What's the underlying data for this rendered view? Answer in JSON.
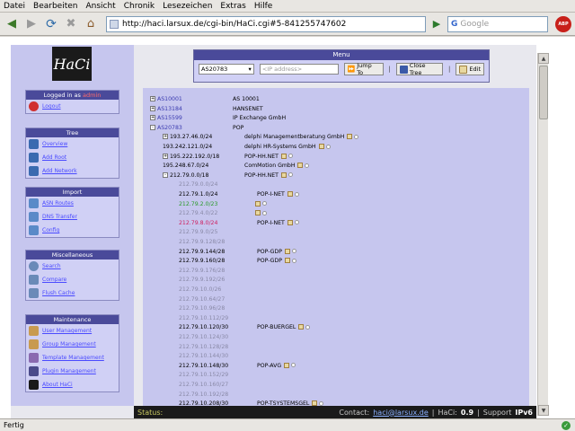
{
  "browser": {
    "menu": [
      "Datei",
      "Bearbeiten",
      "Ansicht",
      "Chronik",
      "Lesezeichen",
      "Extras",
      "Hilfe"
    ],
    "url": "http://haci.larsux.de/cgi-bin/HaCi.cgi#5-841255747602",
    "search_placeholder": "Google",
    "adblock_label": "ABP",
    "status": "Fertig"
  },
  "sidebar": {
    "logo": "HaCi",
    "login": {
      "header": "Logged in as",
      "user": "admin",
      "items": [
        "Logout"
      ]
    },
    "tree": {
      "header": "Tree",
      "items": [
        "Overview",
        "Add Root",
        "Add Network"
      ]
    },
    "import": {
      "header": "Import",
      "items": [
        "ASN Routes",
        "DNS Transfer",
        "Config"
      ]
    },
    "misc": {
      "header": "Miscellaneous",
      "items": [
        "Search",
        "Compare",
        "Flush Cache"
      ]
    },
    "maint": {
      "header": "Maintenance",
      "items": [
        "User Management",
        "Group Management",
        "Template Management",
        "Plugin Management",
        "About HaCi"
      ]
    }
  },
  "menu_panel": {
    "title": "Menu",
    "root_select": "AS20783",
    "ip_placeholder": "<IP address>",
    "jump_label": "Jump To",
    "close_label": "Close Tree",
    "edit_label": "Edit"
  },
  "tree": [
    {
      "exp": "+",
      "net": "AS10001",
      "desc": "AS 10001",
      "cls": "lnk",
      "indent": 0,
      "icons": false
    },
    {
      "exp": "+",
      "net": "AS13184",
      "desc": "HANSENET",
      "cls": "lnk",
      "indent": 0,
      "icons": false
    },
    {
      "exp": "+",
      "net": "AS15599",
      "desc": "IP Exchange GmbH",
      "cls": "lnk",
      "indent": 0,
      "icons": false
    },
    {
      "exp": "-",
      "net": "AS20783",
      "desc": "POP",
      "cls": "lnk",
      "indent": 0,
      "icons": false
    },
    {
      "exp": "+",
      "net": "193.27.46.0/24",
      "desc": "delphi Managementberatung GmbH",
      "cls": "",
      "indent": 1,
      "icons": true
    },
    {
      "exp": "",
      "net": "193.242.121.0/24",
      "desc": "delphi HR-Systems GmbH",
      "cls": "",
      "indent": 1,
      "icons": true
    },
    {
      "exp": "+",
      "net": "195.222.192.0/18",
      "desc": "POP-HH.NET",
      "cls": "",
      "indent": 1,
      "icons": true
    },
    {
      "exp": "",
      "net": "195.248.67.0/24",
      "desc": "ComMotion GmbH",
      "cls": "",
      "indent": 1,
      "icons": true
    },
    {
      "exp": "-",
      "net": "212.79.0.0/18",
      "desc": "POP-HH.NET",
      "cls": "",
      "indent": 1,
      "icons": true
    },
    {
      "exp": "",
      "net": "212.79.0.0/24",
      "desc": "",
      "cls": "grey",
      "indent": 2,
      "icons": false
    },
    {
      "exp": "",
      "net": "212.79.1.0/24",
      "desc": "POP-I-NET",
      "cls": "",
      "indent": 2,
      "icons": true
    },
    {
      "exp": "",
      "net": "212.79.2.0/23",
      "desc": "",
      "cls": "green",
      "indent": 2,
      "icons": true
    },
    {
      "exp": "",
      "net": "212.79.4.0/22",
      "desc": "",
      "cls": "grey",
      "indent": 2,
      "icons": true
    },
    {
      "exp": "",
      "net": "212.79.8.0/24",
      "desc": "POP-I-NET",
      "cls": "pink",
      "indent": 2,
      "icons": true
    },
    {
      "exp": "",
      "net": "212.79.9.0/25",
      "desc": "",
      "cls": "grey",
      "indent": 2,
      "icons": false
    },
    {
      "exp": "",
      "net": "212.79.9.128/28",
      "desc": "",
      "cls": "grey",
      "indent": 2,
      "icons": false
    },
    {
      "exp": "",
      "net": "212.79.9.144/28",
      "desc": "POP-GDP",
      "cls": "",
      "indent": 2,
      "icons": true
    },
    {
      "exp": "",
      "net": "212.79.9.160/28",
      "desc": "POP-GDP",
      "cls": "",
      "indent": 2,
      "icons": true
    },
    {
      "exp": "",
      "net": "212.79.9.176/28",
      "desc": "",
      "cls": "grey",
      "indent": 2,
      "icons": false
    },
    {
      "exp": "",
      "net": "212.79.9.192/26",
      "desc": "",
      "cls": "grey",
      "indent": 2,
      "icons": false
    },
    {
      "exp": "",
      "net": "212.79.10.0/26",
      "desc": "",
      "cls": "grey",
      "indent": 2,
      "icons": false
    },
    {
      "exp": "",
      "net": "212.79.10.64/27",
      "desc": "",
      "cls": "grey",
      "indent": 2,
      "icons": false
    },
    {
      "exp": "",
      "net": "212.79.10.96/28",
      "desc": "",
      "cls": "grey",
      "indent": 2,
      "icons": false
    },
    {
      "exp": "",
      "net": "212.79.10.112/29",
      "desc": "",
      "cls": "grey",
      "indent": 2,
      "icons": false
    },
    {
      "exp": "",
      "net": "212.79.10.120/30",
      "desc": "POP-BUERGEL",
      "cls": "",
      "indent": 2,
      "icons": true
    },
    {
      "exp": "",
      "net": "212.79.10.124/30",
      "desc": "",
      "cls": "grey",
      "indent": 2,
      "icons": false
    },
    {
      "exp": "",
      "net": "212.79.10.128/28",
      "desc": "",
      "cls": "grey",
      "indent": 2,
      "icons": false
    },
    {
      "exp": "",
      "net": "212.79.10.144/30",
      "desc": "",
      "cls": "grey",
      "indent": 2,
      "icons": false
    },
    {
      "exp": "",
      "net": "212.79.10.148/30",
      "desc": "POP-AVG",
      "cls": "",
      "indent": 2,
      "icons": true
    },
    {
      "exp": "",
      "net": "212.79.10.152/29",
      "desc": "",
      "cls": "grey",
      "indent": 2,
      "icons": false
    },
    {
      "exp": "",
      "net": "212.79.10.160/27",
      "desc": "",
      "cls": "grey",
      "indent": 2,
      "icons": false
    },
    {
      "exp": "",
      "net": "212.79.10.192/28",
      "desc": "",
      "cls": "grey",
      "indent": 2,
      "icons": false
    },
    {
      "exp": "",
      "net": "212.79.10.208/30",
      "desc": "POP-TSYSTEMSGEL",
      "cls": "",
      "indent": 2,
      "icons": true
    }
  ],
  "page_status": {
    "label": "Status:",
    "contact_label": "Contact:",
    "contact_email": "haci@larsux.de",
    "version_label": "HaCi:",
    "version": "0.9",
    "support_label": "Support",
    "support_value": "IPv6"
  }
}
